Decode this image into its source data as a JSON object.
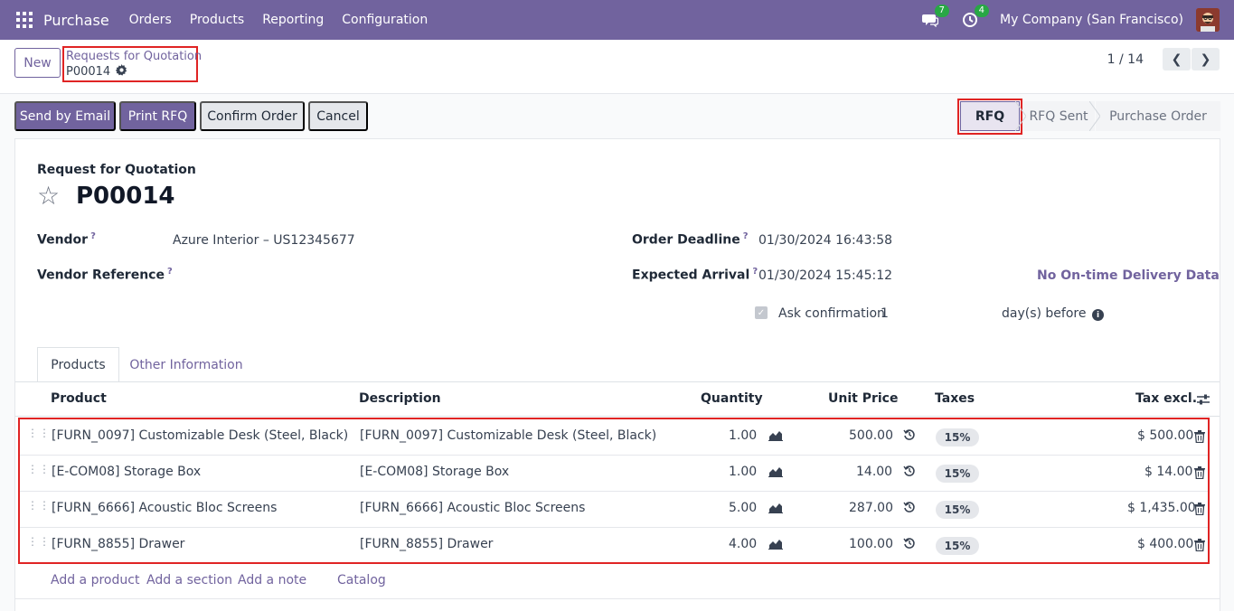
{
  "navbar": {
    "app_name": "Purchase",
    "menu": [
      "Orders",
      "Products",
      "Reporting",
      "Configuration"
    ],
    "messages_count": "7",
    "activities_count": "4",
    "company": "My Company (San Francisco)"
  },
  "control_panel": {
    "new_label": "New",
    "breadcrumb_parent": "Requests for Quotation",
    "breadcrumb_current": "P00014",
    "pager": "1 / 14"
  },
  "actions": {
    "send_email": "Send by Email",
    "print_rfq": "Print RFQ",
    "confirm_order": "Confirm Order",
    "cancel": "Cancel"
  },
  "stages": [
    "RFQ",
    "RFQ Sent",
    "Purchase Order"
  ],
  "form": {
    "doc_type": "Request for Quotation",
    "doc_name": "P00014",
    "vendor_label": "Vendor",
    "vendor_value": "Azure Interior – US12345677",
    "vendor_ref_label": "Vendor Reference",
    "deadline_label": "Order Deadline",
    "deadline_value": "01/30/2024 16:43:58",
    "arrival_label": "Expected Arrival",
    "arrival_value": "01/30/2024 15:45:12",
    "ontime_link": "No On-time Delivery Data",
    "ask_confirmation_label": "Ask confirmation",
    "ask_confirmation_days": "1",
    "days_before": "day(s) before",
    "help_mark": "?"
  },
  "tabs": [
    "Products",
    "Other Information"
  ],
  "table": {
    "headers": {
      "product": "Product",
      "description": "Description",
      "quantity": "Quantity",
      "unit_price": "Unit Price",
      "taxes": "Taxes",
      "tax_excl": "Tax excl."
    },
    "rows": [
      {
        "product": "[FURN_0097] Customizable Desk (Steel, Black)",
        "description": "[FURN_0097] Customizable Desk (Steel, Black)",
        "quantity": "1.00",
        "unit_price": "500.00",
        "tax": "15%",
        "subtotal": "$ 500.00"
      },
      {
        "product": "[E-COM08] Storage Box",
        "description": "[E-COM08] Storage Box",
        "quantity": "1.00",
        "unit_price": "14.00",
        "tax": "15%",
        "subtotal": "$ 14.00"
      },
      {
        "product": "[FURN_6666] Acoustic Bloc Screens",
        "description": "[FURN_6666] Acoustic Bloc Screens",
        "quantity": "5.00",
        "unit_price": "287.00",
        "tax": "15%",
        "subtotal": "$ 1,435.00"
      },
      {
        "product": "[FURN_8855] Drawer",
        "description": "[FURN_8855] Drawer",
        "quantity": "4.00",
        "unit_price": "100.00",
        "tax": "15%",
        "subtotal": "$ 400.00"
      }
    ],
    "add_product": "Add a product",
    "add_section": "Add a section",
    "add_note": "Add a note",
    "catalog": "Catalog"
  }
}
